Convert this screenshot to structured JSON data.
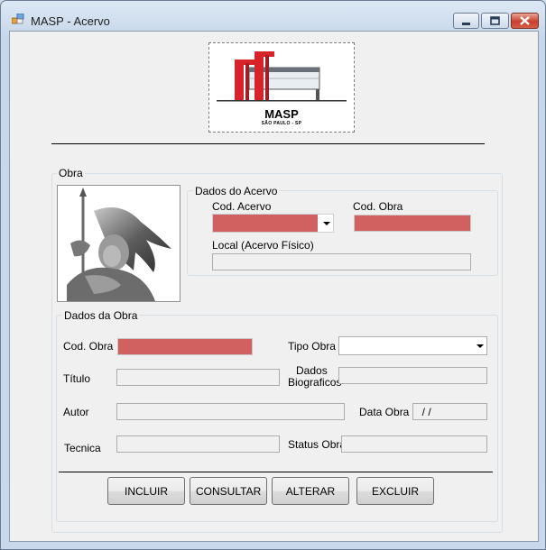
{
  "window": {
    "title": "MASP - Acervo"
  },
  "logo": {
    "name": "MASP",
    "subtitle": "SÃO PAULO - SP"
  },
  "obra_group": {
    "title": "Obra"
  },
  "acervo_group": {
    "title": "Dados do Acervo",
    "cod_acervo_label": "Cod. Acervo",
    "cod_acervo_value": "",
    "cod_obra_label": "Cod. Obra",
    "cod_obra_value": "",
    "local_label": "Local (Acervo Físico)",
    "local_value": ""
  },
  "dados_obra_group": {
    "title": "Dados da Obra",
    "cod_obra_label": "Cod. Obra",
    "cod_obra_value": "",
    "tipo_obra_label": "Tipo Obra",
    "tipo_obra_value": "",
    "titulo_label": "Título",
    "titulo_value": "",
    "dados_biograficos_label_line1": "Dados",
    "dados_biograficos_label_line2": "Biograficos",
    "dados_biograficos_value": "",
    "autor_label": "Autor",
    "autor_value": "",
    "data_obra_label": "Data Obra",
    "data_obra_value": "  / /",
    "tecnica_label": "Tecnica",
    "tecnica_value": "",
    "status_obra_label": "Status Obra",
    "status_obra_value": ""
  },
  "buttons": {
    "incluir": "INCLUIR",
    "consultar": "CONSULTAR",
    "alterar": "ALTERAR",
    "excluir": "EXCLUIR"
  },
  "colors": {
    "required_field": "#d16161",
    "logo_red": "#d8232a"
  }
}
